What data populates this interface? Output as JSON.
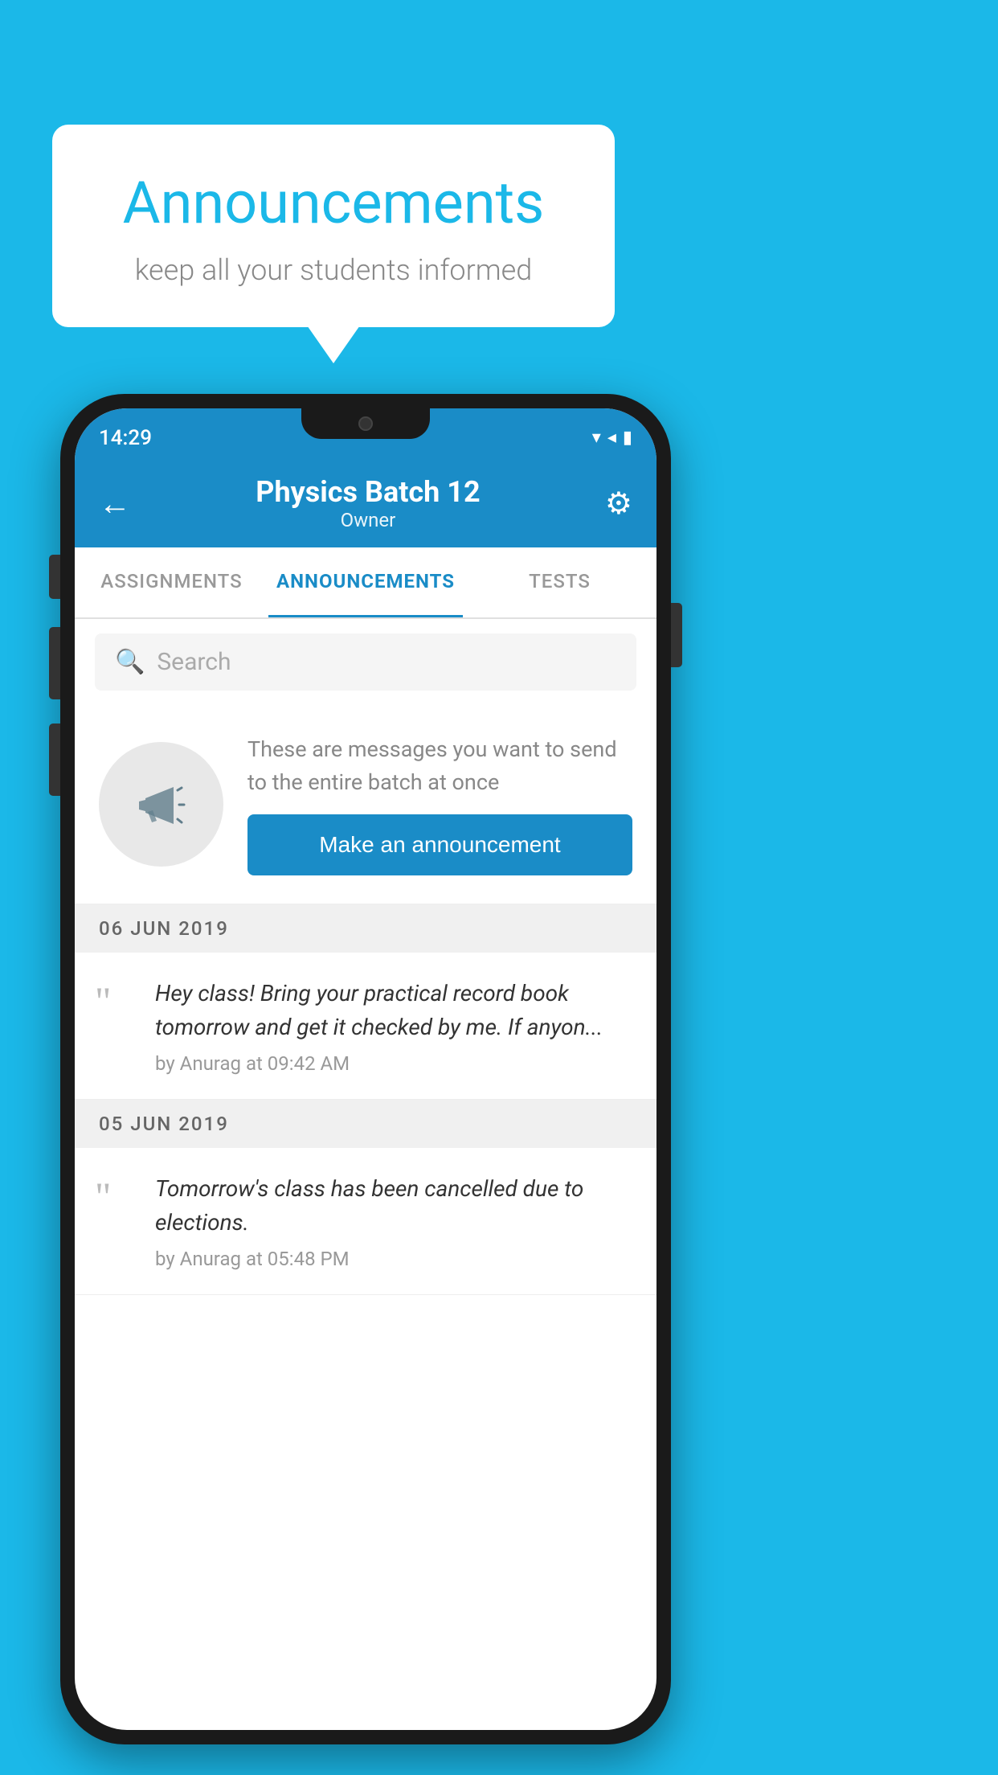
{
  "bubble": {
    "title": "Announcements",
    "subtitle": "keep all your students informed"
  },
  "statusBar": {
    "time": "14:29",
    "icons": "▾◂▮"
  },
  "header": {
    "title": "Physics Batch 12",
    "subtitle": "Owner",
    "backLabel": "←",
    "settingsLabel": "⚙"
  },
  "tabs": [
    {
      "label": "ASSIGNMENTS",
      "active": false
    },
    {
      "label": "ANNOUNCEMENTS",
      "active": true
    },
    {
      "label": "TESTS",
      "active": false
    }
  ],
  "search": {
    "placeholder": "Search"
  },
  "promoCard": {
    "description": "These are messages you want to send to the entire batch at once",
    "buttonLabel": "Make an announcement"
  },
  "announcements": [
    {
      "date": "06  JUN  2019",
      "text": "Hey class! Bring your practical record book tomorrow and get it checked by me. If anyon...",
      "meta": "by Anurag at 09:42 AM"
    },
    {
      "date": "05  JUN  2019",
      "text": "Tomorrow's class has been cancelled due to elections.",
      "meta": "by Anurag at 05:48 PM"
    }
  ],
  "colors": {
    "background": "#1bb8e8",
    "headerBg": "#1a8cc7",
    "activeTab": "#1a8cc7",
    "buttonBg": "#1a8cc7"
  }
}
